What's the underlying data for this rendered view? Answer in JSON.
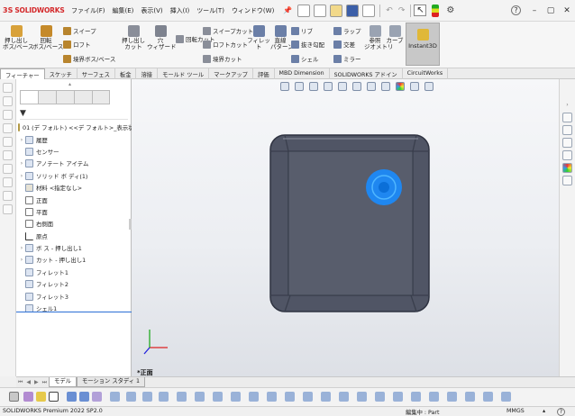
{
  "app": {
    "logo_ds": "3S",
    "logo_text": "SOLIDWORKS"
  },
  "menu": [
    "ファイル(F)",
    "編集(E)",
    "表示(V)",
    "挿入(I)",
    "ツール(T)",
    "ウィンドウ(W)"
  ],
  "commands": {
    "extrude_boss": "押し出し\nボス/ベース",
    "revolve_boss": "回転\nボス/ベース",
    "sweep": "スイープ",
    "loft": "ロフト",
    "boundary_boss": "境界ボス/ベース",
    "extrude_cut": "押し出し\nカット",
    "hole_wizard": "穴\nウィザード",
    "revolve_cut": "回転カット",
    "sweep_cut": "スイープカット",
    "loft_cut": "ロフトカット",
    "boundary_cut": "境界カット",
    "fillet": "フィレット",
    "linear_pattern": "直線\nパターン",
    "rib": "リブ",
    "draft": "抜き勾配",
    "shell": "シェル",
    "wrap": "ラップ",
    "intersect": "交差",
    "mirror": "ミラー",
    "reference_geometry": "参照\nジオメトリ",
    "curves": "カーブ",
    "instant3d": "Instant3D"
  },
  "tabs": [
    "フィーチャー",
    "スケッチ",
    "サーフェス",
    "板金",
    "溶接",
    "モールド ツール",
    "マークアップ",
    "評価",
    "MBD Dimension",
    "SOLIDWORKS アドイン",
    "CircuitWorks"
  ],
  "tree": [
    {
      "label": "01 (デ フォルト) <<デ フォルト>_表示状態 1>",
      "expand": ""
    },
    {
      "label": "履歴",
      "expand": "›"
    },
    {
      "label": "センサー",
      "expand": ""
    },
    {
      "label": "アノテート アイテム",
      "expand": "›"
    },
    {
      "label": "ソリッド ボ ディ(1)",
      "expand": "›"
    },
    {
      "label": "材料 <指定なし>",
      "expand": ""
    },
    {
      "label": "正面",
      "expand": ""
    },
    {
      "label": "平面",
      "expand": ""
    },
    {
      "label": "右側面",
      "expand": ""
    },
    {
      "label": "原点",
      "expand": ""
    },
    {
      "label": "ボ ス - 押し出し1",
      "expand": "›"
    },
    {
      "label": "カット - 押し出し1",
      "expand": "›"
    },
    {
      "label": "フィレット1",
      "expand": ""
    },
    {
      "label": "フィレット2",
      "expand": ""
    },
    {
      "label": "フィレット3",
      "expand": ""
    },
    {
      "label": "シェル1",
      "expand": ""
    }
  ],
  "viewport": {
    "view_label": "*正面"
  },
  "bottom_tabs": {
    "model": "モデル",
    "motion": "モーション スタディ 1"
  },
  "status": {
    "version": "SOLIDWORKS Premium 2022 SP2.0",
    "mode": "編集中 : Part",
    "units": "MMGS"
  },
  "colors": {
    "accent": "#2b6fd6",
    "part": "#505565",
    "hole": "#1a8cff",
    "logo": "#d4282a"
  }
}
